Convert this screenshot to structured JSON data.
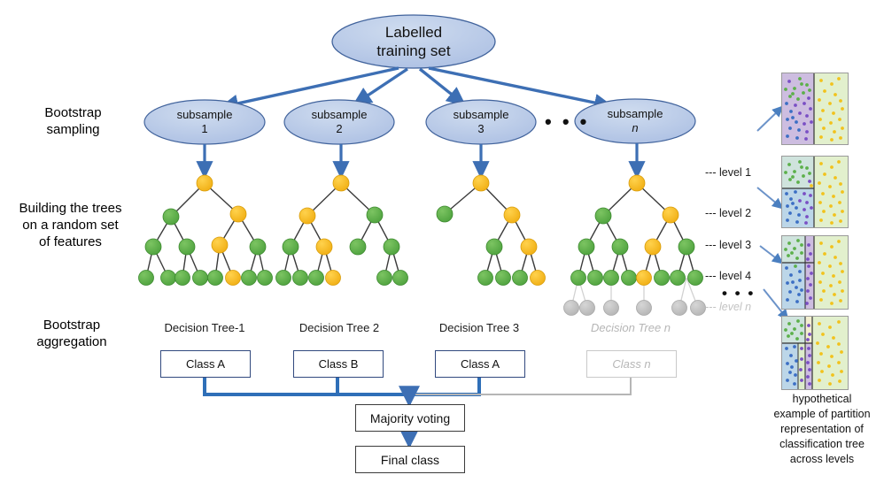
{
  "diagram": {
    "title_node": "Labelled\ntraining set",
    "root_line1": "Labelled",
    "root_line2": "training set",
    "stages": [
      {
        "id": "bootstrap-sampling",
        "line1": "Bootstrap",
        "line2": "sampling"
      },
      {
        "id": "building-trees",
        "line1": "Building the trees",
        "line2": "on a random set",
        "line3": "of features"
      },
      {
        "id": "bootstrap-aggregation",
        "line1": "Bootstrap",
        "line2": "aggregation"
      }
    ],
    "subsamples": [
      {
        "word": "subsample",
        "index": "1",
        "muted": false
      },
      {
        "word": "subsample",
        "index": "2",
        "muted": false
      },
      {
        "word": "subsample",
        "index": "3",
        "muted": false
      },
      {
        "word": "subsample",
        "index": "n",
        "muted": true
      }
    ],
    "subsample_ellipsis": "• • •",
    "tree_names": [
      "Decision Tree-1",
      "Decision Tree 2",
      "Decision Tree 3",
      "Decision Tree n"
    ],
    "class_boxes": [
      "Class A",
      "Class B",
      "Class A",
      "Class n"
    ],
    "majority_voting": "Majority voting",
    "final_class": "Final class",
    "level_labels": [
      "--- level 1",
      "--- level 2",
      "--- level 3",
      "--- level 4",
      "--- level n"
    ],
    "level_ellipsis": "• • •",
    "panel_caption_lines": [
      "hypothetical",
      "example of partition",
      "representation of",
      "classification tree",
      "across levels"
    ],
    "colors": {
      "ellipse_fill": "#aec1e3",
      "ellipse_stroke": "#41639c",
      "arrow_blue": "#3d6fb4",
      "node_green": "#5cb04a",
      "node_yellow": "#f5b919",
      "node_gray": "#bdbdbd",
      "box_border": "#31497e",
      "muted_gray": "#c0c0c0",
      "panel_left_bg": "#cfe3dd",
      "panel_right_bg": "#dff0cc",
      "dot_blue": "#3c6fc4",
      "dot_green": "#5cb04a",
      "dot_purple": "#7a4fc4",
      "dot_yellow": "#f2c21c",
      "panel_purple_bg": "#cdbde0"
    }
  },
  "trees": {
    "tree1": {
      "levels": [
        [
          "Y"
        ],
        [
          "G",
          "Y"
        ],
        [
          "G",
          "G",
          "Y",
          "G"
        ],
        [
          "G",
          "G",
          "G",
          "G",
          "G",
          "Y",
          "G",
          "G"
        ]
      ]
    },
    "tree2": {
      "levels": [
        [
          "Y"
        ],
        [
          "Y",
          "G"
        ],
        [
          "G",
          "Y",
          "G",
          "G"
        ],
        [
          "G",
          "G",
          "G",
          "Y",
          "-",
          "-",
          "G",
          "G"
        ]
      ]
    },
    "tree3": {
      "levels": [
        [
          "Y"
        ],
        [
          "G",
          "Y"
        ],
        [
          "-",
          "-",
          "G",
          "Y"
        ],
        [
          "-",
          "-",
          "-",
          "-",
          "G",
          "G",
          "G",
          "Y"
        ]
      ]
    },
    "treen": {
      "levels": [
        [
          "Y"
        ],
        [
          "G",
          "Y"
        ],
        [
          "G",
          "G",
          "Y",
          "G"
        ],
        [
          "G",
          "G",
          "G",
          "G",
          "Y",
          "G",
          "G",
          "G"
        ],
        [
          "N",
          "N",
          "N",
          "-",
          "N",
          "-",
          "N",
          "-",
          "-",
          "N",
          "-",
          "N"
        ]
      ]
    }
  }
}
